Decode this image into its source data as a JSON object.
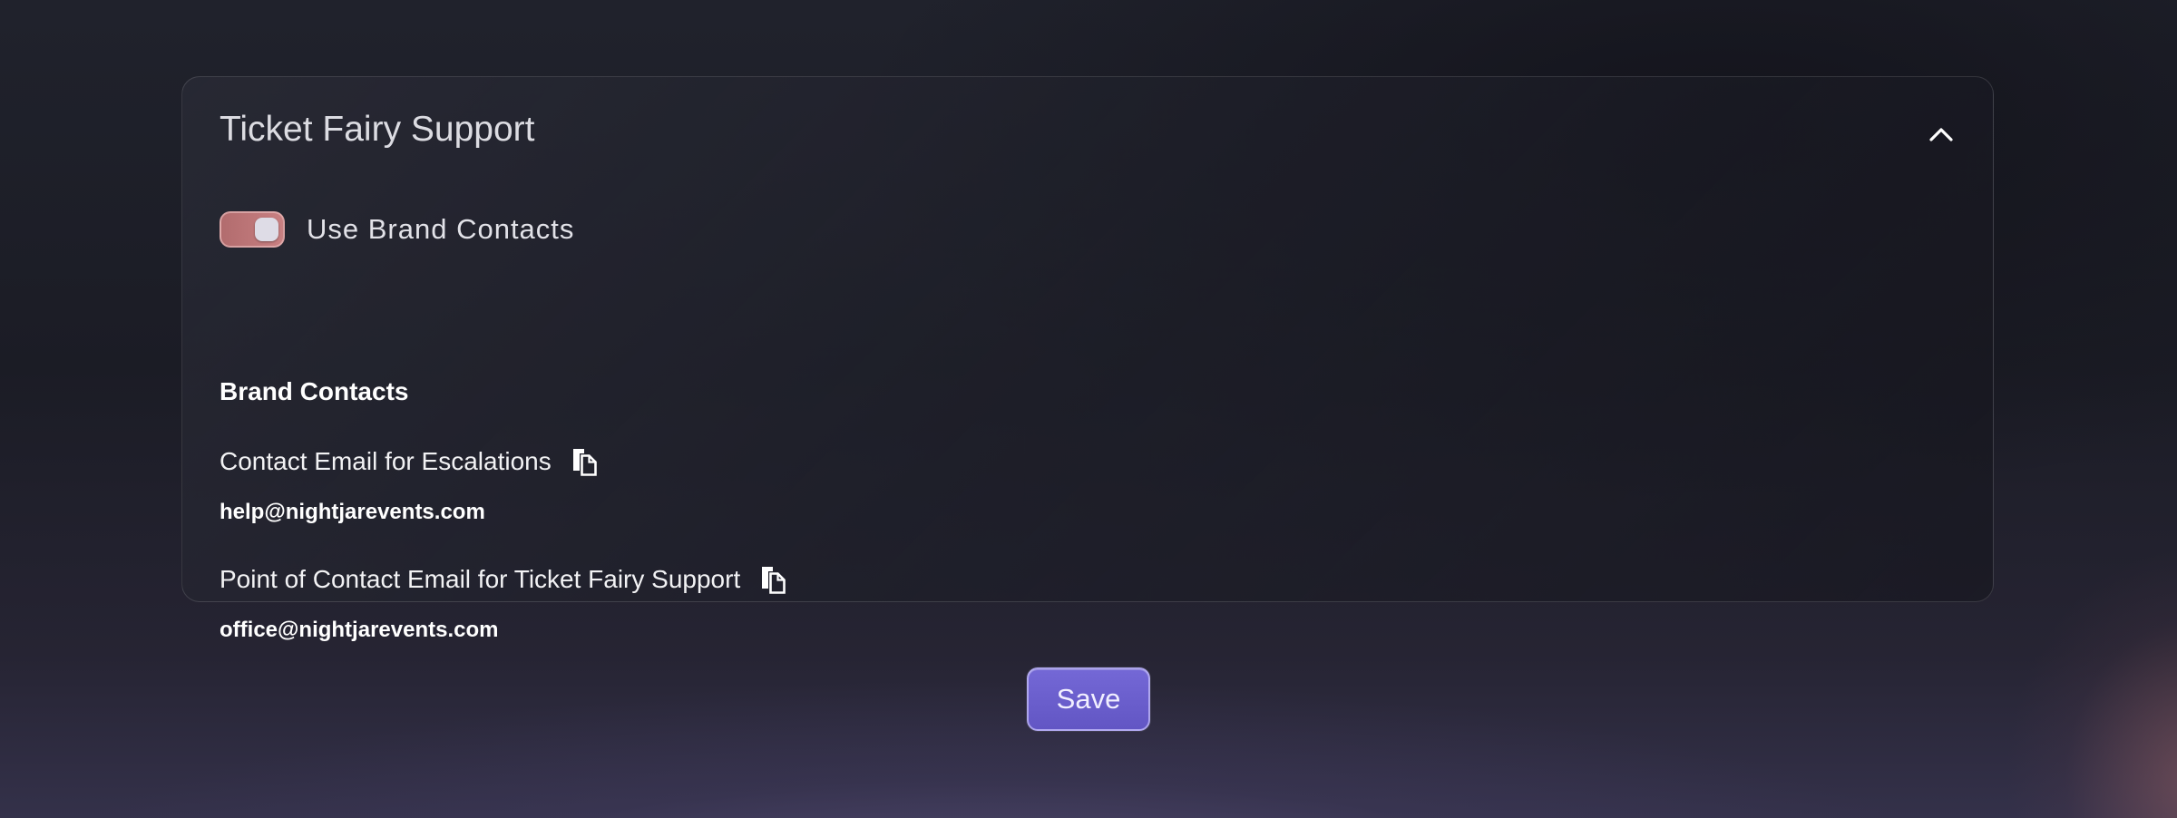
{
  "panel": {
    "title": "Ticket Fairy Support",
    "collapse_icon": "chevron-up-icon"
  },
  "toggle": {
    "label": "Use Brand Contacts",
    "checked": true,
    "color": "#c07a7c"
  },
  "brand_contacts": {
    "heading": "Brand Contacts",
    "contacts": [
      {
        "label": "Contact Email for Escalations",
        "value": "help@nightjarevents.com",
        "copy_icon": "copy-icon"
      },
      {
        "label": "Point of Contact Email for Ticket Fairy Support",
        "value": "office@nightjarevents.com",
        "copy_icon": "copy-icon"
      }
    ]
  },
  "actions": {
    "save_label": "Save",
    "accent_color": "#6c60d0"
  }
}
